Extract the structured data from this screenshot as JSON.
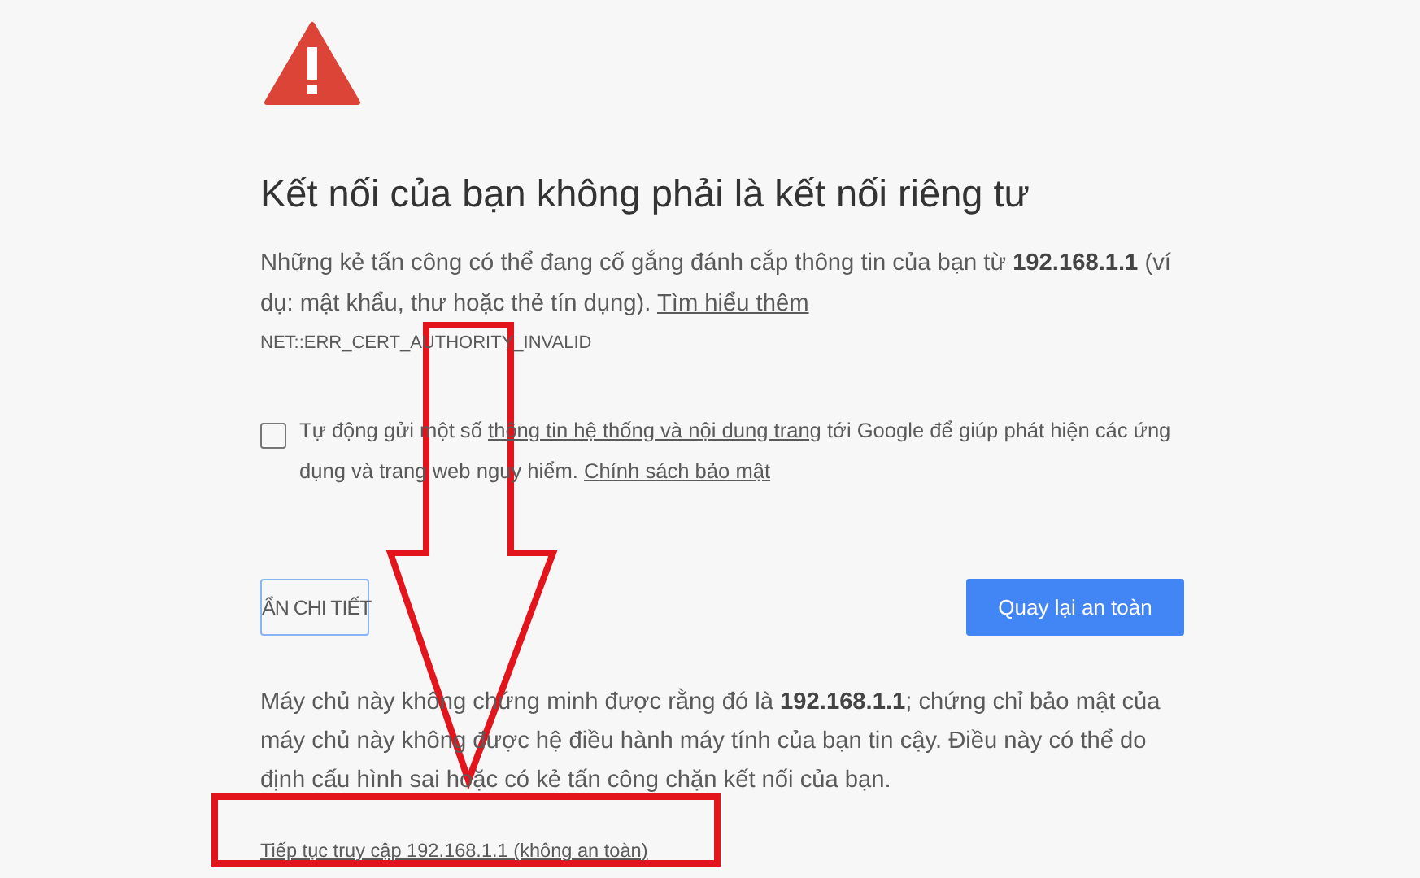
{
  "heading": "Kết nối của bạn không phải là kết nối riêng tư",
  "intro": {
    "text": "Những kẻ tấn công có thể đang cố gắng đánh cắp thông tin của bạn từ **192.168.1.1** (ví dụ: mật khẩu, thư hoặc thẻ tín dụng).",
    "link": "Tìm hiểu thêm"
  },
  "error_code": "NET::ERR_CERT_AUTHORITY_INVALID",
  "report": {
    "checked": false,
    "before": "Tự động gửi một số",
    "link": "thông tin hệ thống và nội dung trang",
    "after": "tới Google để giúp phát hiện các ứng dụng và trang web nguy hiểm.",
    "policy_link": "Chính sách bảo mật"
  },
  "details_button": "ẨN CHI TIẾT",
  "back_button": "Quay lại an toàn",
  "details": "Máy chủ này không chứng minh được rằng đó là **192.168.1.1**; chứng chỉ bảo mật của máy chủ này không được hệ điều hành máy tính của bạn tin cậy. Điều này có thể do định cấu hình sai hoặc có kẻ tấn công chặn kết nối của bạn.",
  "proceed_link": "Tiếp tục truy cập 192.168.1.1 (không an toàn)"
}
